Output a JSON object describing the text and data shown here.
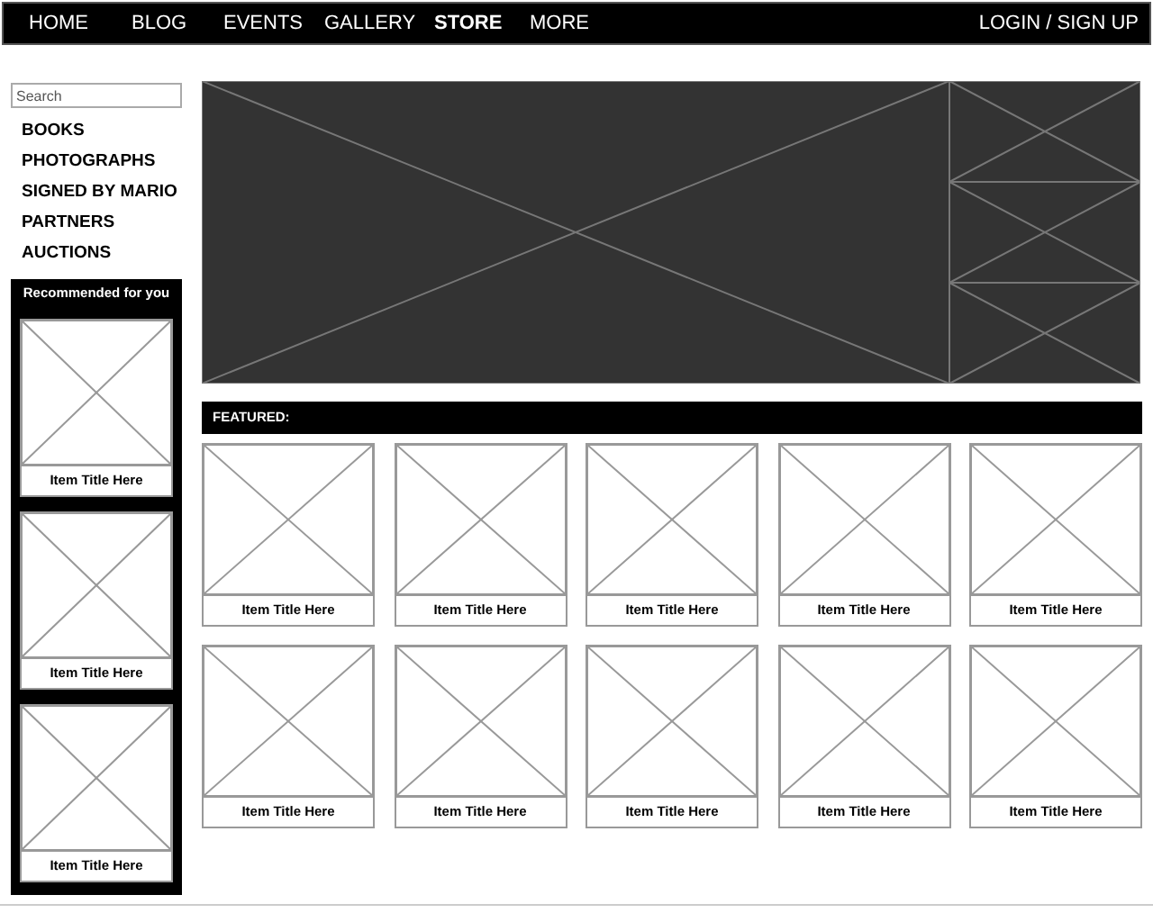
{
  "nav": {
    "items": [
      {
        "label": "HOME",
        "selected": false
      },
      {
        "label": "BLOG",
        "selected": false
      },
      {
        "label": "EVENTS",
        "selected": false
      },
      {
        "label": "GALLERY",
        "selected": false
      },
      {
        "label": "STORE",
        "selected": true
      },
      {
        "label": "MORE",
        "selected": false
      }
    ],
    "login": "LOGIN / SIGN UP"
  },
  "sidebar": {
    "search": {
      "placeholder": "Search"
    },
    "categories": [
      "BOOKS",
      "PHOTOGRAPHS",
      "SIGNED BY MARIO",
      "PARTNERS",
      "AUCTIONS"
    ],
    "recommended": {
      "title": "Recommended for you",
      "items": [
        "Item Title Here",
        "Item Title Here",
        "Item Title Here"
      ]
    }
  },
  "featured": {
    "title": "FEATURED:",
    "items": [
      "Item Title Here",
      "Item Title Here",
      "Item Title Here",
      "Item Title Here",
      "Item Title Here",
      "Item Title Here",
      "Item Title Here",
      "Item Title Here",
      "Item Title Here",
      "Item Title Here"
    ]
  }
}
